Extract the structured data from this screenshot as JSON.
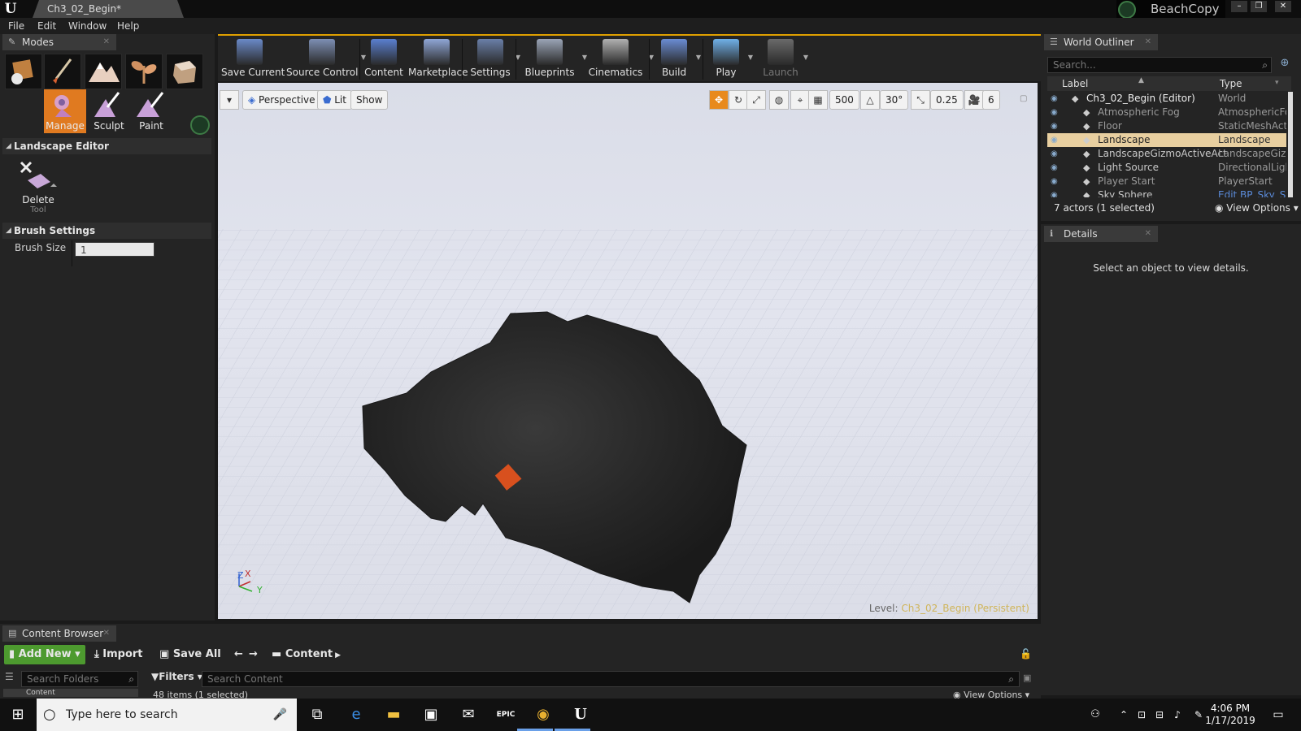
{
  "window": {
    "document_tab": "Ch3_02_Begin*",
    "project_name": "BeachCopy",
    "controls": [
      "–",
      "❐",
      "✕"
    ]
  },
  "menu": [
    "File",
    "Edit",
    "Window",
    "Help"
  ],
  "modes": {
    "title": "Modes",
    "mode_icons": [
      "place-icon",
      "paint-brush-icon",
      "landscape-icon",
      "foliage-icon",
      "geometry-icon"
    ],
    "sub_tools": [
      "Manage",
      "Sculpt",
      "Paint"
    ],
    "landscape_editor": {
      "title": "Landscape Editor",
      "tool_label": "Delete",
      "tool_sublabel": "Tool"
    },
    "brush_settings": {
      "title": "Brush Settings",
      "brush_size_label": "Brush Size",
      "brush_size_value": "1"
    }
  },
  "toolbar": {
    "buttons": [
      {
        "label": "Save Current",
        "color": "#6a89c8"
      },
      {
        "label": "Source Control",
        "color": "#7d8fb4"
      },
      {
        "label": "Content",
        "color": "#5a7fd0"
      },
      {
        "label": "Marketplace",
        "color": "#8fa6d6"
      },
      {
        "label": "Settings",
        "color": "#6a7fa8"
      },
      {
        "label": "Blueprints",
        "color": "#9aa4b6"
      },
      {
        "label": "Cinematics",
        "color": "#b0b0b0"
      },
      {
        "label": "Build",
        "color": "#6a8cd4"
      },
      {
        "label": "Play",
        "color": "#6fb0e8"
      },
      {
        "label": "Launch",
        "color": "#6a6a6a"
      }
    ]
  },
  "viewport": {
    "perspective_label": "Perspective",
    "lit_label": "Lit",
    "show_label": "Show",
    "grid_snap": "500",
    "rotation_snap": "30°",
    "scale_snap": "0.25",
    "camera_speed": "6",
    "level_label": "Level:",
    "level_value": "Ch3_02_Begin (Persistent)",
    "axis_z": "Z",
    "axis_x": "X",
    "axis_y": "Y"
  },
  "world_outliner": {
    "title": "World Outliner",
    "search_placeholder": "Search...",
    "col_label": "Label",
    "col_type": "Type",
    "rows": [
      {
        "label": "Ch3_02_Begin (Editor)",
        "type": "World",
        "icon": "world-icon"
      },
      {
        "label": "Atmospheric Fog",
        "type": "AtmosphericFog",
        "icon": "fog-icon"
      },
      {
        "label": "Floor",
        "type": "StaticMeshActor",
        "icon": "mesh-icon"
      },
      {
        "label": "Landscape",
        "type": "Landscape",
        "icon": "landscape-icon"
      },
      {
        "label": "LandscapeGizmoActiveActor",
        "type": "LandscapeGizmo",
        "icon": "gizmo-icon"
      },
      {
        "label": "Light Source",
        "type": "DirectionalLight",
        "icon": "light-icon"
      },
      {
        "label": "Player Start",
        "type": "PlayerStart",
        "icon": "player-start-icon"
      },
      {
        "label": "Sky Sphere",
        "type": "Edit BP_Sky_S",
        "icon": "sphere-icon"
      }
    ],
    "status": "7 actors (1 selected)",
    "view_options": "View Options"
  },
  "details": {
    "title": "Details",
    "empty_message": "Select an object to view details."
  },
  "content_browser": {
    "title": "Content Browser",
    "add_new": "Add New",
    "import": "Import",
    "save_all": "Save All",
    "path_root": "Content",
    "search_folders_placeholder": "Search Folders",
    "filters": "Filters",
    "search_content_placeholder": "Search Content",
    "items_status": "48 items (1 selected)",
    "view_options": "View Options",
    "folder_row": "Content"
  },
  "taskbar": {
    "search_placeholder": "Type here to search",
    "time": "4:06 PM",
    "date": "1/17/2019"
  }
}
